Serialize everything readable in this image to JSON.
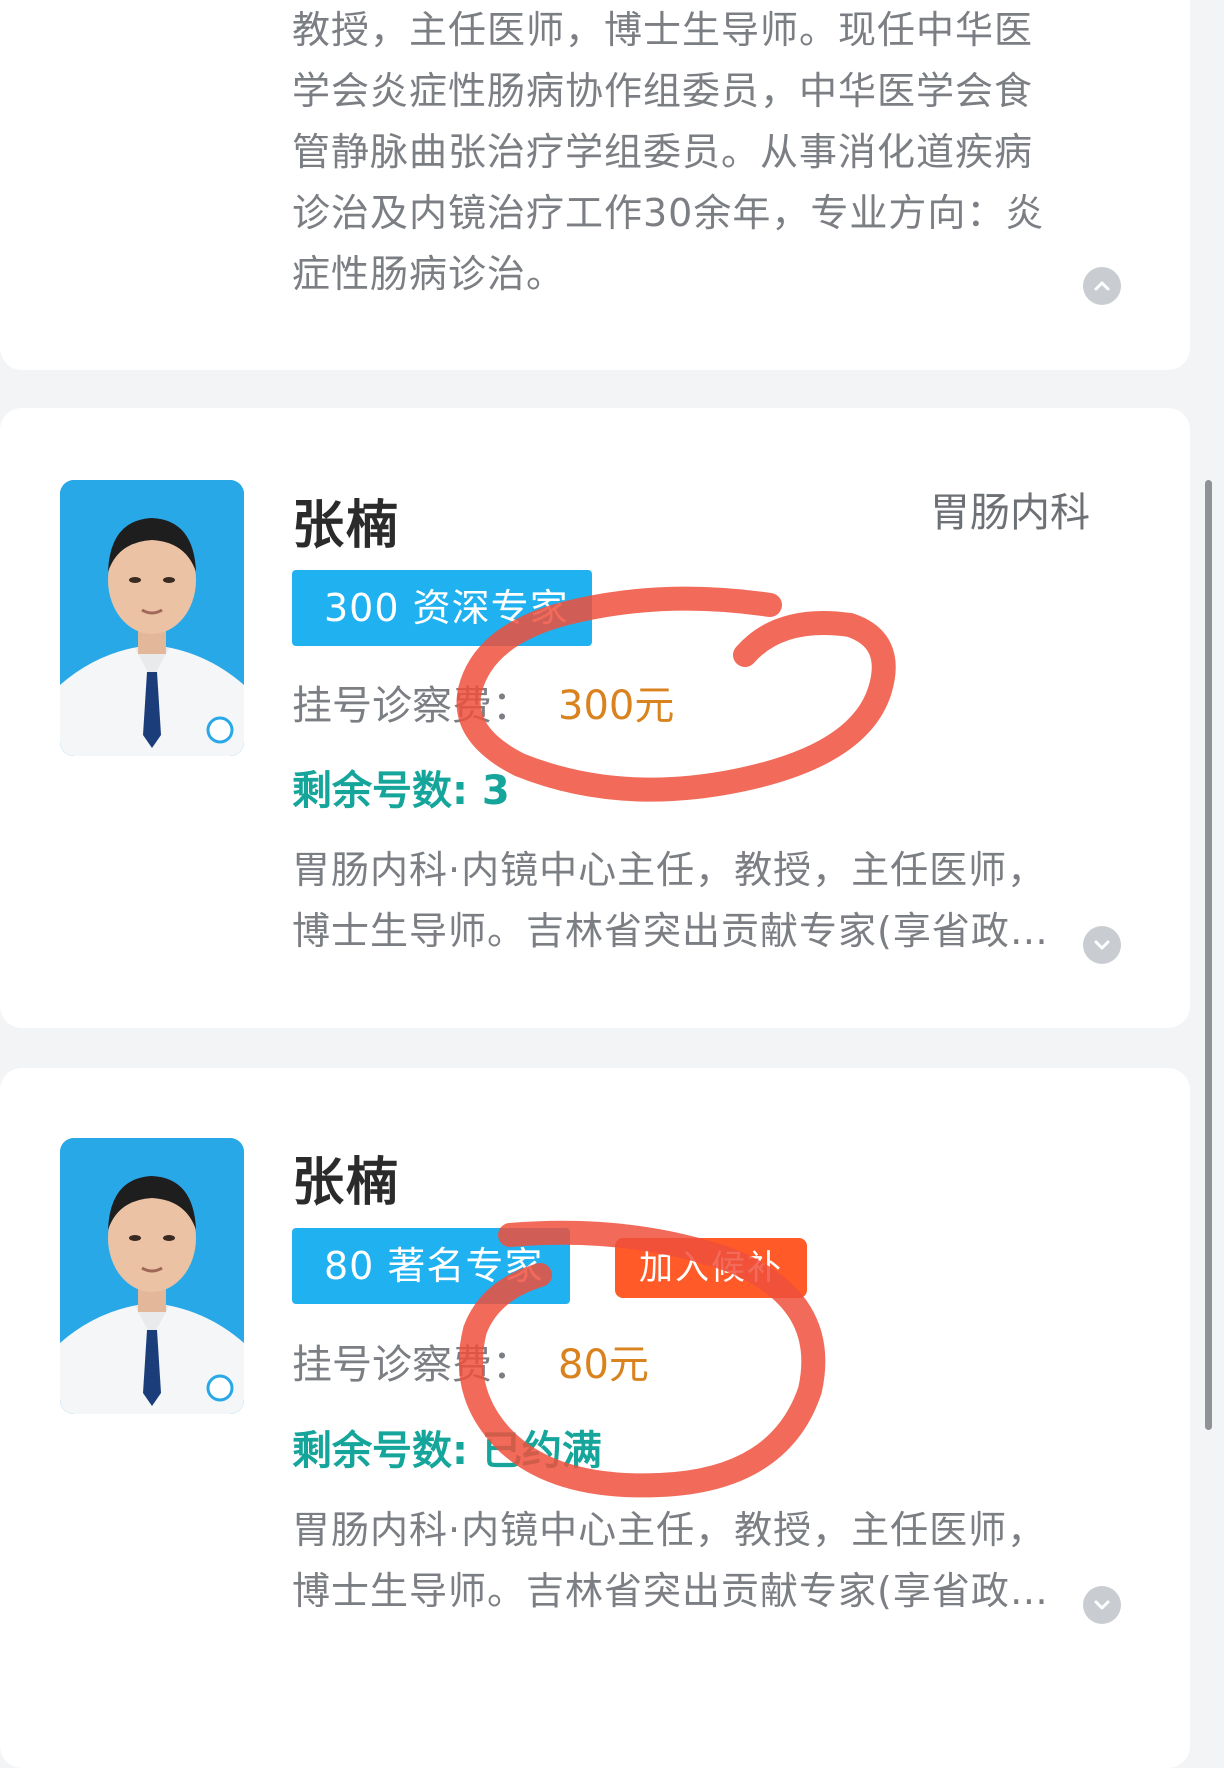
{
  "top_card": {
    "bio_lines": [
      "教授，主任医师，博士生导师。现任中华医",
      "学会炎症性肠病协作组委员，中华医学会食",
      "管静脉曲张治疗学组委员。从事消化道疾病",
      "诊治及内镜治疗工作30余年，专业方向：炎",
      "症性肠病诊治。"
    ],
    "toggle_icon": "chevron-up-icon"
  },
  "doctors": [
    {
      "name": "张楠",
      "department": "胃肠内科",
      "tag": "300 资深专家",
      "fee_label": "挂号诊察费：",
      "fee_value": "300元",
      "remaining": "剩余号数: 3",
      "bio_lines": [
        "胃肠内科·内镜中心主任，教授，主任医师，",
        "博士生导师。吉林省突出贡献专家(享省政…"
      ],
      "toggle_icon": "chevron-down-icon"
    },
    {
      "name": "张楠",
      "tag": "80 著名专家",
      "waitlist_button": "加入候补",
      "fee_label": "挂号诊察费：",
      "fee_value": "80元",
      "remaining": "剩余号数: 已约满",
      "bio_lines": [
        "胃肠内科·内镜中心主任，教授，主任医师，",
        "博士生导师。吉林省突出贡献专家(享省政…"
      ],
      "toggle_icon": "chevron-down-icon"
    }
  ],
  "colors": {
    "tag_blue": "#1fb1f0",
    "fee_orange": "#d9821e",
    "remaining_teal": "#15a59a",
    "waitlist_red": "#ff5a28",
    "annotation_red": "#f0503c"
  }
}
